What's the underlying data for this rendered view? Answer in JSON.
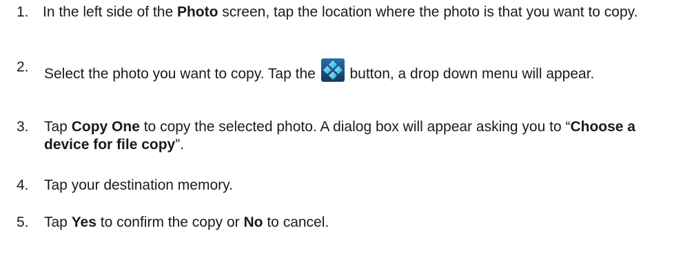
{
  "steps": [
    {
      "number": "1.",
      "t1": "In the left side of the ",
      "b1": "Photo",
      "t2": " screen, tap the location where the photo is that you want to copy."
    },
    {
      "number": "2.",
      "t1": "Select the photo you want to copy.  Tap the ",
      "icon": "menu-diamond-icon",
      "t2": " button, a drop down menu will appear."
    },
    {
      "number": "3.",
      "t1": "Tap ",
      "b1": "Copy One",
      "t2": " to copy the selected photo.  A dialog box will appear asking you to “",
      "b2": "Choose a device for file copy",
      "t3": "”."
    },
    {
      "number": "4.",
      "t1": "Tap your destination memory."
    },
    {
      "number": "5.",
      "t1": "Tap ",
      "b1": "Yes",
      "t2": " to confirm the copy or ",
      "b2": "No",
      "t3": " to cancel."
    }
  ],
  "colors": {
    "text": "#1a1a1a",
    "icon_background": "#1d5a8a",
    "icon_accent": "#4fc3e8"
  }
}
